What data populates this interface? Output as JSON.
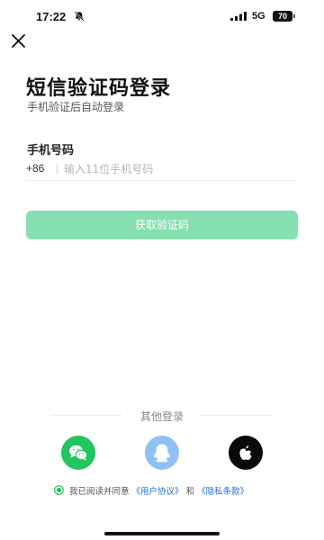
{
  "status_bar": {
    "time": "17:22",
    "network": "5G",
    "battery": "70",
    "icons": [
      "bell-off-icon",
      "signal-icon",
      "battery-icon"
    ]
  },
  "header": {
    "close_icon": "close-icon"
  },
  "main": {
    "title": "短信验证码登录",
    "subtitle": "手机验证后自动登录",
    "phone_label": "手机号码",
    "country_code": "+86",
    "phone_placeholder": "输入11位手机号码",
    "phone_value": "",
    "get_code_label": "获取验证码"
  },
  "other_login": {
    "label": "其他登录",
    "providers": [
      "wechat-icon",
      "qq-icon",
      "apple-icon"
    ]
  },
  "agreement": {
    "checked": true,
    "prefix": "我已阅读并同意",
    "user_agreement": "《用户协议》",
    "connector": "和",
    "privacy_policy": "《隐私条款》"
  },
  "colors": {
    "primary_button": "#86dfb1",
    "wechat": "#22c55e",
    "qq": "#8ec2f5",
    "apple": "#0a0a0a",
    "link": "#1a6fd6",
    "check": "#22c55e"
  }
}
